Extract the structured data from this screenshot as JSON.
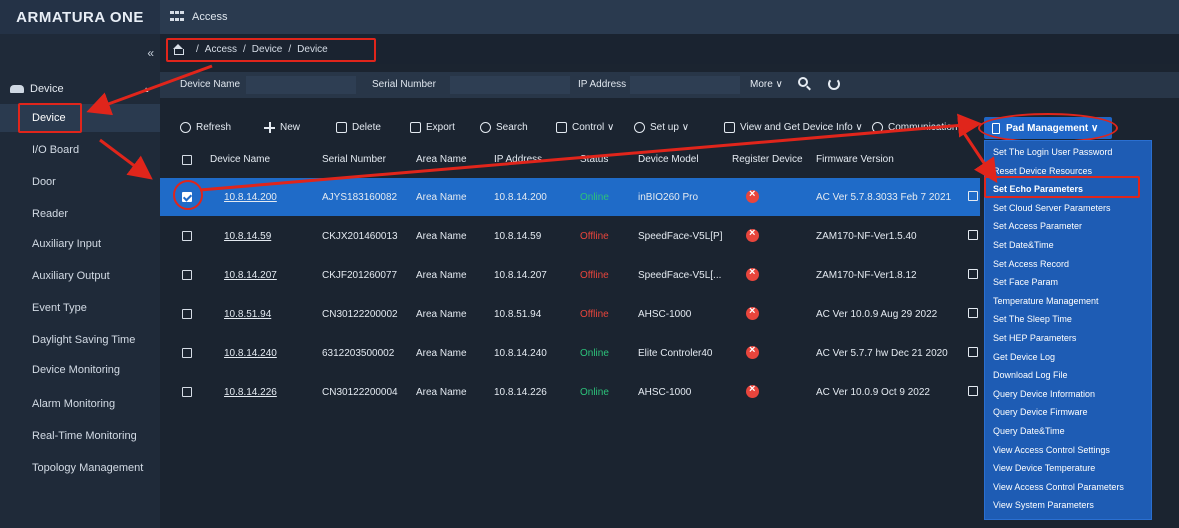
{
  "topbar": {
    "brand": "ARMATURA ONE",
    "app_label": "Access"
  },
  "sidebar": {
    "collapse_glyph": "«",
    "group": {
      "label": "Device",
      "caret": "▲"
    },
    "items": [
      {
        "label": "Device"
      },
      {
        "label": "I/O Board"
      },
      {
        "label": "Door"
      },
      {
        "label": "Reader"
      },
      {
        "label": "Auxiliary Input"
      },
      {
        "label": "Auxiliary Output"
      },
      {
        "label": "Event Type"
      },
      {
        "label": "Daylight Saving Time"
      },
      {
        "label": "Device Monitoring"
      },
      {
        "label": "Alarm Monitoring"
      },
      {
        "label": "Real-Time Monitoring"
      },
      {
        "label": "Topology Management"
      }
    ]
  },
  "breadcrumb": {
    "sep": "/",
    "items": [
      "Access",
      "Device",
      "Device"
    ]
  },
  "filters": {
    "device_name": "Device Name",
    "serial_number": "Serial Number",
    "ip_address": "IP Address",
    "more": "More ∨"
  },
  "toolbar": {
    "refresh": "Refresh",
    "new": "New",
    "delete": "Delete",
    "export": "Export",
    "search": "Search",
    "control": "Control ∨",
    "setup": "Set up ∨",
    "view_get": "View and Get Device Info ∨",
    "communication": "Communication ∨",
    "pad_management": "Pad Management ∨"
  },
  "table": {
    "headers": [
      "Device Name",
      "Serial Number",
      "Area Name",
      "IP Address",
      "Status",
      "Device Model",
      "Register Device",
      "Firmware Version"
    ],
    "rows": [
      {
        "name": "10.8.14.200",
        "serial": "AJYS183160082",
        "area": "Area Name",
        "ip": "10.8.14.200",
        "status": "Online",
        "model": "inBIO260 Pro",
        "firmware": "AC Ver 5.7.8.3033 Feb 7 2021",
        "selected": true
      },
      {
        "name": "10.8.14.59",
        "serial": "CKJX201460013",
        "area": "Area Name",
        "ip": "10.8.14.59",
        "status": "Offline",
        "model": "SpeedFace-V5L[P]",
        "firmware": "ZAM170-NF-Ver1.5.40",
        "selected": false
      },
      {
        "name": "10.8.14.207",
        "serial": "CKJF201260077",
        "area": "Area Name",
        "ip": "10.8.14.207",
        "status": "Offline",
        "model": "SpeedFace-V5L[...",
        "firmware": "ZAM170-NF-Ver1.8.12",
        "selected": false
      },
      {
        "name": "10.8.51.94",
        "serial": "CN30122200002",
        "area": "Area Name",
        "ip": "10.8.51.94",
        "status": "Offline",
        "model": "AHSC-1000",
        "firmware": "AC Ver 10.0.9 Aug 29 2022",
        "selected": false
      },
      {
        "name": "10.8.14.240",
        "serial": "6312203500002",
        "area": "Area Name",
        "ip": "10.8.14.240",
        "status": "Online",
        "model": "Elite Controler40",
        "firmware": "AC Ver 5.7.7 hw Dec 21 2020",
        "selected": false
      },
      {
        "name": "10.8.14.226",
        "serial": "CN30122200004",
        "area": "Area Name",
        "ip": "10.8.14.226",
        "status": "Online",
        "model": "AHSC-1000",
        "firmware": "AC Ver 10.0.9 Oct 9 2022",
        "selected": false
      }
    ]
  },
  "dropdown": {
    "items": [
      "Set The Login User Password",
      "Reset Device Resources",
      "Set Echo Parameters",
      "Set Cloud Server Parameters",
      "Set Access Parameter",
      "Set Date&Time",
      "Set Access Record",
      "Set Face Param",
      "Temperature Management",
      "Set The Sleep Time",
      "Set HEP Parameters",
      "Get Device Log",
      "Download Log File",
      "Query Device Information",
      "Query Device Firmware",
      "Query Date&Time",
      "View Access Control Settings",
      "View Device Temperature",
      "View Access Control Parameters",
      "View System Parameters"
    ]
  },
  "colors": {
    "accent": "#1f6bc8",
    "highlight": "#e0251b",
    "online": "#2cc27a",
    "offline": "#e8453c"
  }
}
